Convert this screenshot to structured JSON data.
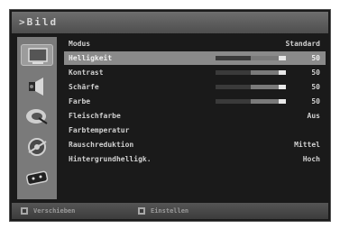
{
  "header": {
    "title": ">Bild"
  },
  "sidebar": {
    "items": [
      {
        "icon": "tv-screen-icon",
        "selected": true
      },
      {
        "icon": "speaker-icon",
        "selected": false
      },
      {
        "icon": "satellite-dish-icon",
        "selected": false
      },
      {
        "icon": "settings-gear-icon",
        "selected": false
      },
      {
        "icon": "remote-control-icon",
        "selected": false
      }
    ]
  },
  "menu": {
    "items": [
      {
        "label": "Modus",
        "value": "Standard",
        "bar": null
      },
      {
        "label": "Helligkeit",
        "value": "50",
        "bar": 0.5
      },
      {
        "label": "Kontrast",
        "value": "50",
        "bar": 0.5
      },
      {
        "label": "Schärfe",
        "value": "50",
        "bar": 0.5
      },
      {
        "label": "Farbe",
        "value": "50",
        "bar": 0.5
      },
      {
        "label": "Fleischfarbe",
        "value": "Aus",
        "bar": null
      },
      {
        "label": "Farbtemperatur",
        "value": "",
        "bar": null
      },
      {
        "label": "Rauschreduktion",
        "value": "Mittel",
        "bar": null
      },
      {
        "label": "Hintergrundhelligk.",
        "value": "Hoch",
        "bar": null
      }
    ]
  },
  "footer": {
    "move_label": "Verschieben",
    "set_label": "Einstellen"
  },
  "colors": {
    "highlight": "#8a8a8a",
    "bar_fill": "#3a3a3a",
    "bar_track": "#e8e8e8"
  }
}
